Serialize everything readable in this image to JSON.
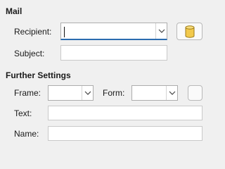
{
  "mail": {
    "heading": "Mail",
    "recipient_label": "Recipient:",
    "recipient_value": "",
    "subject_label": "Subject:",
    "subject_value": "",
    "database_button_icon": "database-icon"
  },
  "further_settings": {
    "heading": "Further Settings",
    "frame_label": "Frame:",
    "frame_value": "",
    "form_label": "Form:",
    "form_value": "",
    "text_label": "Text:",
    "text_value": "",
    "name_label": "Name:",
    "name_value": ""
  },
  "colors": {
    "background": "#f0f0f0",
    "focus_underline": "#2b6cb0",
    "database_icon_fill": "#f2c94c"
  }
}
